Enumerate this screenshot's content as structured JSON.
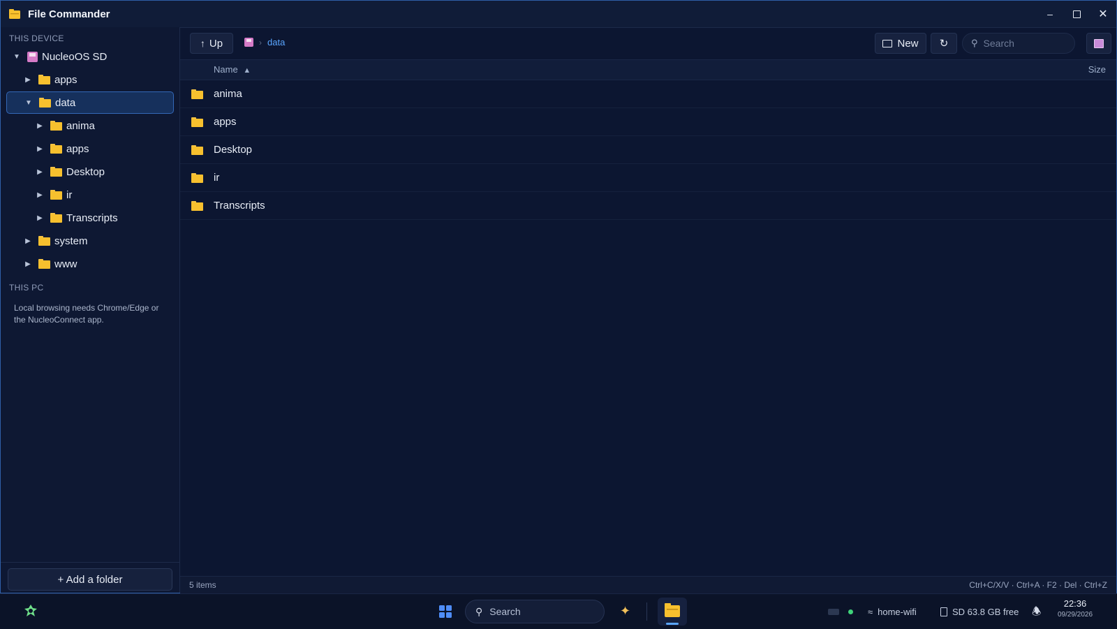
{
  "window": {
    "title": "File Commander",
    "controls": [
      "minimize",
      "maximize",
      "close"
    ]
  },
  "sidebar": {
    "this_device_label": "THIS DEVICE",
    "drive_label": "NucleoOS SD",
    "tree": [
      {
        "label": "apps",
        "level": 1,
        "expanded": false,
        "selected": false
      },
      {
        "label": "data",
        "level": 1,
        "expanded": true,
        "selected": true
      },
      {
        "label": "anima",
        "level": 2,
        "expanded": false,
        "selected": false
      },
      {
        "label": "apps",
        "level": 2,
        "expanded": false,
        "selected": false
      },
      {
        "label": "Desktop",
        "level": 2,
        "expanded": false,
        "selected": false
      },
      {
        "label": "ir",
        "level": 2,
        "expanded": false,
        "selected": false
      },
      {
        "label": "Transcripts",
        "level": 2,
        "expanded": false,
        "selected": false
      },
      {
        "label": "system",
        "level": 1,
        "expanded": false,
        "selected": false
      },
      {
        "label": "www",
        "level": 1,
        "expanded": false,
        "selected": false
      }
    ],
    "this_pc_label": "THIS PC",
    "pc_note": "Local browsing needs Chrome/Edge or the NucleoConnect app.",
    "add_folder_label": "+ Add a folder"
  },
  "toolbar": {
    "up_label": "Up",
    "breadcrumb_current": "data",
    "new_label": "New",
    "search_placeholder": "Search"
  },
  "list": {
    "col_name": "Name",
    "col_size": "Size",
    "sort": "ascending",
    "items": [
      "anima",
      "apps",
      "Desktop",
      "ir",
      "Transcripts"
    ]
  },
  "status": {
    "count": "5 items",
    "shortcuts": "Ctrl+C/X/V · Ctrl+A · F2 · Del · Ctrl+Z"
  },
  "taskbar": {
    "search_label": "Search",
    "wifi_label": "home-wifi",
    "storage_label": "SD 63.8 GB free",
    "time": "22:36",
    "date": "09/29/2026"
  },
  "colors": {
    "accent": "#5aa6ff",
    "folder": "#f7c02e",
    "background": "#0c1631",
    "selection": "#16305c"
  }
}
